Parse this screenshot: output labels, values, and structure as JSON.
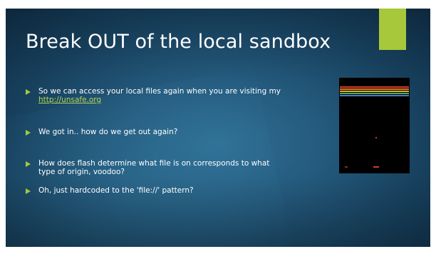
{
  "slide": {
    "title": "Break OUT of the local sandbox",
    "bullets": [
      {
        "line1": "So we can access your local files again when you are visiting my",
        "link": "http://unsafe.org"
      },
      {
        "line1": "We got in.. how do we get out again?"
      },
      {
        "line1": "How does flash determine what file is on corresponds to what",
        "line2": "type of origin, voodoo?"
      },
      {
        "line1": "Oh, just hardcoded to the 'file://' pattern?"
      }
    ]
  },
  "colors": {
    "accent": "#a6c83a",
    "background": "#245a7d",
    "link": "#b5d650",
    "brick_rows": [
      "#d9392b",
      "#e07a2c",
      "#d8b23a",
      "#6aa83a",
      "#3a7fd0"
    ]
  },
  "icons": {
    "bullet": "triangle-arrow-right",
    "game": "breakout-game-screenshot"
  }
}
